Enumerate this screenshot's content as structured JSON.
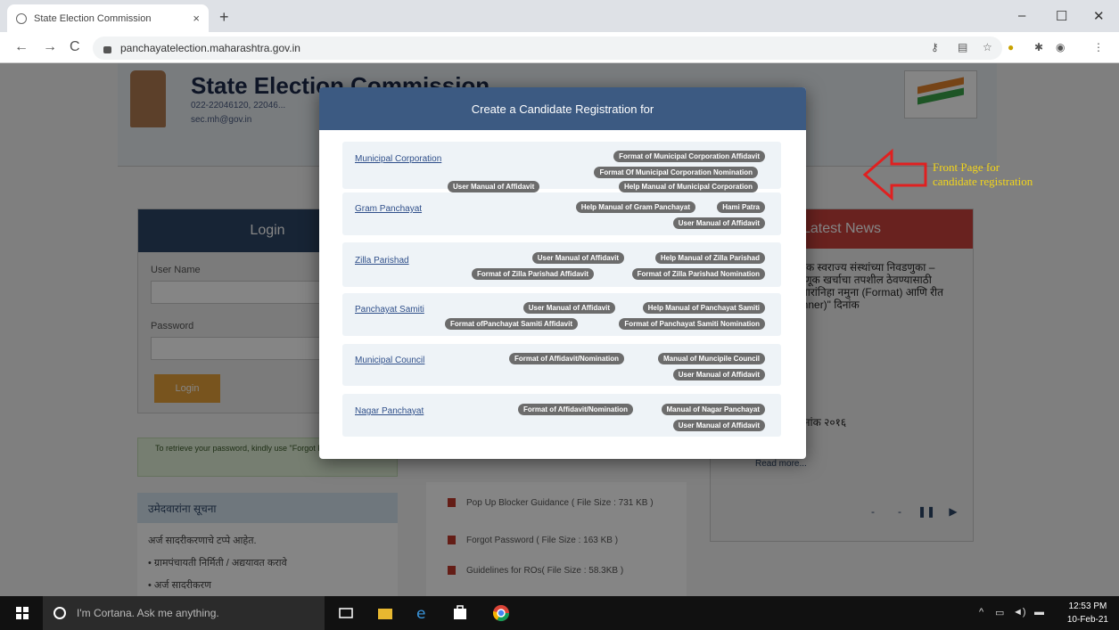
{
  "browser": {
    "tab_title": "State Election Commission",
    "tab_close": "×",
    "new_tab": "+",
    "url": "panchayatelection.maharashtra.gov.in",
    "window_controls": [
      "–",
      "☐",
      "✕"
    ],
    "nav": [
      "←",
      "→",
      "C"
    ]
  },
  "header": {
    "title": "State Election Commission",
    "phone": "022-22046120, 22046...",
    "email": "sec.mh@gov.in"
  },
  "login": {
    "heading": "Login",
    "username_label": "User Name",
    "password_label": "Password",
    "login_button": "Login",
    "forgot_note": "To retrieve your password, kindly use \"Forgot Password\" option"
  },
  "important": {
    "heading": "उमेदवारांना सूचना",
    "line1": "अर्ज सादरीकरणाचे टप्पे आहेत.",
    "line2": "• ग्रामपंचायती निर्मिती / अद्ययावत करावे",
    "line3": "• अर्ज सादरीकरण"
  },
  "news": {
    "heading": "Latest News",
    "item1": "स्थानिक स्वराज्य संस्थांच्या निवडणुका – निवडणूक खर्चाचा तपशील ठेवण्यासाठी उमेदवारांनिहा नमुना (Format) आणि रीत (Manner)\" दिनांक",
    "item2": "... दिनांक २०१६",
    "read_more": "Read more...",
    "carousel": [
      "-",
      "-",
      "❚❚",
      "▶"
    ]
  },
  "downloads": [
    "Pop Up Blocker Guidance ( File Size : 731 KB )",
    "Forgot Password ( File Size : 163 KB )",
    "Guidelines for ROs( File Size : 58.3KB )"
  ],
  "modal": {
    "title": "Create a Candidate Registration for",
    "rows": [
      {
        "name": "Municipal Corporation",
        "badges": [
          "Format of Municipal Corporation Affidavit",
          "Format Of Municipal Corporation Nomination",
          "User Manual of Affidavit",
          "Help Manual of Municipal Corporation"
        ]
      },
      {
        "name": "Gram Panchayat",
        "badges": [
          "Help Manual of Gram Panchayat",
          "Hami Patra",
          "User Manual of Affidavit"
        ]
      },
      {
        "name": "Zilla Parishad",
        "badges": [
          "User Manual of Affidavit",
          "Help Manual of Zilla Parishad",
          "Format of Zilla Parishad Affidavit",
          "Format of Zilla Parishad Nomination"
        ]
      },
      {
        "name": "Panchayat Samiti",
        "badges": [
          "User Manual of Affidavit",
          "Help Manual of Panchayat Samiti",
          "Format ofPanchayat Samiti Affidavit",
          "Format of Panchayat Samiti Nomination"
        ]
      },
      {
        "name": "Municipal Council",
        "badges": [
          "Format of Affidavit/Nomination",
          "Manual of Muncipile Council",
          "User Manual of Affidavit"
        ]
      },
      {
        "name": "Nagar Panchayat",
        "badges": [
          "Format of Affidavit/Nomination",
          "Manual of Nagar Panchayat",
          "User Manual of Affidavit"
        ]
      }
    ]
  },
  "annotation": {
    "text": "Front Page for candidate registration",
    "color": "#f2d51b",
    "arrow_color": "#e02020"
  },
  "taskbar": {
    "cortana": "I'm Cortana. Ask me anything.",
    "time": "12:53 PM",
    "date": "10-Feb-21"
  }
}
